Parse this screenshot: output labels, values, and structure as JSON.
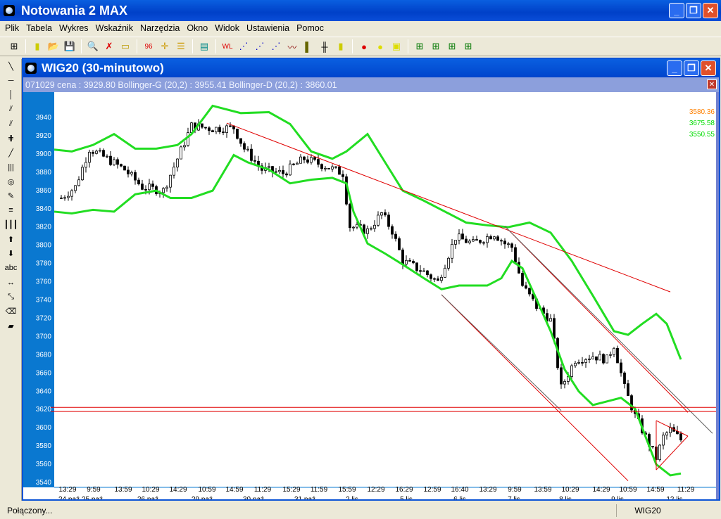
{
  "app": {
    "title": "Notowania 2 MAX"
  },
  "menu": [
    "Plik",
    "Tabela",
    "Wykres",
    "Wskaźnik",
    "Narzędzia",
    "Okno",
    "Widok",
    "Ustawienia",
    "Pomoc"
  ],
  "child": {
    "title": "WIG20 (30-minutowo)",
    "info": "071029  cena : 3929.80 Bollinger-G (20,2) : 3955.41 Bollinger-D (20,2) : 3860.01"
  },
  "left_tools": {
    "abc": "abc"
  },
  "legend_values": [
    {
      "text": "3580.36",
      "color": "#ff8000"
    },
    {
      "text": "3675.58",
      "color": "#00dd00"
    },
    {
      "text": "3550.55",
      "color": "#00dd00"
    }
  ],
  "status": {
    "left": "Połączony...",
    "right": "WIG20"
  },
  "colors": {
    "band": "#22dd22",
    "trend": "#e00000",
    "axis_panel": "#0a78d0"
  },
  "chart_data": {
    "type": "candlestick",
    "ylim": [
      3530,
      3960
    ],
    "yticks": [
      3940,
      3920,
      3900,
      3880,
      3860,
      3840,
      3820,
      3800,
      3780,
      3760,
      3740,
      3720,
      3700,
      3680,
      3660,
      3640,
      3620,
      3600,
      3580,
      3560,
      3540
    ],
    "xlim": [
      0,
      188
    ],
    "xtick_times": [
      "13:29",
      "9:59",
      "13:59",
      "10:29",
      "14:29",
      "10:59",
      "14:59",
      "11:29",
      "15:29",
      "11:59",
      "15:59",
      "12:29",
      "16:29",
      "12:59",
      "16:40",
      "13:29",
      "9:59",
      "13:59",
      "10:29",
      "14:29",
      "10:59",
      "14:59",
      "11:29"
    ],
    "xtick_dates": [
      "24 paź",
      "25 paź",
      "26 paź",
      "29 paź",
      "30 paź",
      "31 paź",
      "2 lis",
      "5 lis",
      "6 lis",
      "7 lis",
      "8 lis",
      "9 lis",
      "12 lis"
    ],
    "close_path": [
      [
        2,
        3851
      ],
      [
        6,
        3863
      ],
      [
        10,
        3905
      ],
      [
        15,
        3894
      ],
      [
        20,
        3882
      ],
      [
        25,
        3863
      ],
      [
        31,
        3859
      ],
      [
        35,
        3894
      ],
      [
        39,
        3930
      ],
      [
        45,
        3927
      ],
      [
        51,
        3928
      ],
      [
        54,
        3905
      ],
      [
        59,
        3882
      ],
      [
        65,
        3878
      ],
      [
        71,
        3894
      ],
      [
        77,
        3886
      ],
      [
        82,
        3878
      ],
      [
        84,
        3820
      ],
      [
        89,
        3815
      ],
      [
        93,
        3834
      ],
      [
        96,
        3815
      ],
      [
        99,
        3782
      ],
      [
        105,
        3770
      ],
      [
        109,
        3759
      ],
      [
        112,
        3789
      ],
      [
        114,
        3808
      ],
      [
        119,
        3801
      ],
      [
        125,
        3812
      ],
      [
        128,
        3801
      ],
      [
        130,
        3797
      ],
      [
        133,
        3755
      ],
      [
        137,
        3732
      ],
      [
        141,
        3717
      ],
      [
        144,
        3643
      ],
      [
        148,
        3674
      ],
      [
        153,
        3678
      ],
      [
        157,
        3674
      ],
      [
        159,
        3690
      ],
      [
        162,
        3643
      ],
      [
        165,
        3612
      ],
      [
        168,
        3589
      ],
      [
        171,
        3566
      ],
      [
        173,
        3589
      ],
      [
        175,
        3597
      ],
      [
        178,
        3586
      ]
    ],
    "bollinger_upper": [
      [
        0,
        3904
      ],
      [
        5,
        3902
      ],
      [
        11,
        3909
      ],
      [
        17,
        3921
      ],
      [
        23,
        3905
      ],
      [
        29,
        3905
      ],
      [
        35,
        3909
      ],
      [
        39,
        3921
      ],
      [
        45,
        3952
      ],
      [
        53,
        3944
      ],
      [
        61,
        3945
      ],
      [
        67,
        3932
      ],
      [
        73,
        3902
      ],
      [
        79,
        3894
      ],
      [
        83,
        3902
      ],
      [
        89,
        3921
      ],
      [
        94,
        3890
      ],
      [
        99,
        3859
      ],
      [
        105,
        3848
      ],
      [
        111,
        3836
      ],
      [
        117,
        3824
      ],
      [
        123,
        3821
      ],
      [
        129,
        3819
      ],
      [
        135,
        3824
      ],
      [
        141,
        3813
      ],
      [
        147,
        3782
      ],
      [
        153,
        3744
      ],
      [
        159,
        3705
      ],
      [
        163,
        3701
      ],
      [
        167,
        3713
      ],
      [
        171,
        3724
      ],
      [
        174,
        3713
      ],
      [
        178,
        3674
      ]
    ],
    "bollinger_lower": [
      [
        0,
        3836
      ],
      [
        5,
        3834
      ],
      [
        11,
        3838
      ],
      [
        17,
        3836
      ],
      [
        23,
        3855
      ],
      [
        29,
        3859
      ],
      [
        33,
        3851
      ],
      [
        39,
        3851
      ],
      [
        45,
        3859
      ],
      [
        51,
        3898
      ],
      [
        55,
        3890
      ],
      [
        61,
        3882
      ],
      [
        67,
        3867
      ],
      [
        73,
        3871
      ],
      [
        79,
        3873
      ],
      [
        83,
        3867
      ],
      [
        85,
        3836
      ],
      [
        89,
        3801
      ],
      [
        94,
        3790
      ],
      [
        99,
        3778
      ],
      [
        105,
        3763
      ],
      [
        110,
        3751
      ],
      [
        115,
        3755
      ],
      [
        123,
        3755
      ],
      [
        127,
        3763
      ],
      [
        130,
        3782
      ],
      [
        133,
        3774
      ],
      [
        137,
        3740
      ],
      [
        141,
        3705
      ],
      [
        145,
        3663
      ],
      [
        149,
        3639
      ],
      [
        153,
        3624
      ],
      [
        157,
        3628
      ],
      [
        161,
        3632
      ],
      [
        165,
        3620
      ],
      [
        168,
        3589
      ],
      [
        171,
        3559
      ],
      [
        175,
        3547
      ],
      [
        178,
        3549
      ]
    ],
    "trendlines": [
      {
        "color": "#e00000",
        "from": [
          49,
          3933
        ],
        "to": [
          175,
          3748
        ]
      },
      {
        "color": "#e00000",
        "from": [
          110,
          3745
        ],
        "to": [
          163,
          3541
        ]
      },
      {
        "color": "#e00000",
        "from": [
          128,
          3820
        ],
        "to": [
          180,
          3616
        ]
      },
      {
        "color": "#606060",
        "from": [
          128,
          3820
        ],
        "to": [
          187,
          3593
        ]
      },
      {
        "color": "#606060",
        "from": [
          110,
          3745
        ],
        "to": [
          144,
          3618
        ]
      },
      {
        "color": "#e00000",
        "from": [
          -1,
          3621.5
        ],
        "to": [
          188,
          3621.5
        ]
      },
      {
        "color": "#e00000",
        "from": [
          -1,
          3617
        ],
        "to": [
          188,
          3617
        ]
      },
      {
        "color": "#e00000",
        "from": [
          171,
          3607
        ],
        "to": [
          180,
          3590
        ]
      },
      {
        "color": "#e00000",
        "from": [
          180,
          3590
        ],
        "to": [
          171,
          3553
        ]
      },
      {
        "color": "#e00000",
        "from": [
          171,
          3553
        ],
        "to": [
          171,
          3607
        ]
      }
    ]
  }
}
